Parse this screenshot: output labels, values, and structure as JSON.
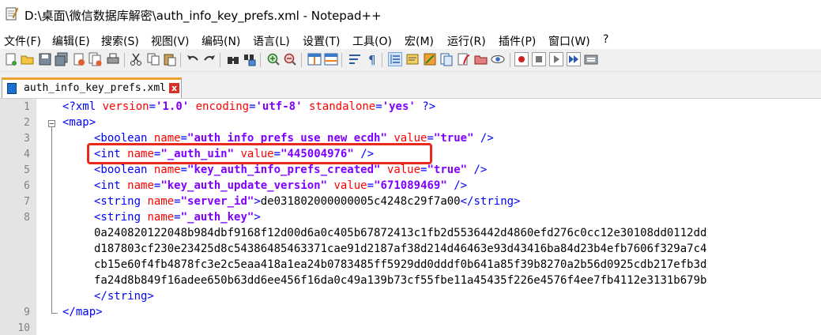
{
  "window": {
    "title": "D:\\桌面\\微信数据库解密\\auth_info_key_prefs.xml - Notepad++"
  },
  "menu": [
    {
      "label": "文件(F)"
    },
    {
      "label": "编辑(E)"
    },
    {
      "label": "搜索(S)"
    },
    {
      "label": "视图(V)"
    },
    {
      "label": "编码(N)"
    },
    {
      "label": "语言(L)"
    },
    {
      "label": "设置(T)"
    },
    {
      "label": "工具(O)"
    },
    {
      "label": "宏(M)"
    },
    {
      "label": "运行(R)"
    },
    {
      "label": "插件(P)"
    },
    {
      "label": "窗口(W)"
    },
    {
      "label": "?"
    }
  ],
  "toolbar": {
    "icons": [
      "new-file-icon",
      "open-file-icon",
      "save-icon",
      "save-all-icon",
      "close-icon",
      "close-all-icon",
      "print-icon",
      "cut-icon",
      "copy-icon",
      "paste-icon",
      "undo-icon",
      "redo-icon",
      "find-icon",
      "replace-icon",
      "zoom-in-icon",
      "zoom-out-icon",
      "sync-vertical-icon",
      "sync-horizontal-icon",
      "word-wrap-icon",
      "show-all-chars-icon",
      "indent-guide-icon",
      "language-icon",
      "doc-map-icon",
      "function-list-icon",
      "folder-workspace-icon",
      "monitoring-icon",
      "record-macro-icon",
      "stop-macro-icon",
      "play-macro-icon",
      "run-macro-multiple-icon",
      "save-macro-icon"
    ]
  },
  "tab": {
    "label": "auth_info_key_prefs.xml",
    "close": "x"
  },
  "line_numbers": [
    "1",
    "2",
    "3",
    "4",
    "5",
    "6",
    "7",
    "8",
    "9",
    "10"
  ],
  "lines": {
    "l1": {
      "p1": "<?xml ",
      "a1": "version",
      "p2": "=",
      "v1": "'1.0'",
      "p3": " ",
      "a2": "encoding",
      "p4": "=",
      "v2": "'utf-8'",
      "p5": " ",
      "a3": "standalone",
      "p6": "=",
      "v3": "'yes'",
      "p7": " ?>"
    },
    "l2": {
      "t1": "<map>"
    },
    "l3": {
      "t1": "<boolean ",
      "a1": "name",
      "t2": "=",
      "v1": "\"auth_info_prefs_use_new_ecdh\"",
      "t3": " ",
      "a2": "value",
      "t4": "=",
      "v2": "\"true\"",
      "t5": " />"
    },
    "l4": {
      "t1": "<int ",
      "a1": "name",
      "t2": "=",
      "v1": "\"_auth_uin\"",
      "t3": " ",
      "a2": "value",
      "t4": "=",
      "v2": "\"445004976\"",
      "t5": " />"
    },
    "l5": {
      "t1": "<boolean ",
      "a1": "name",
      "t2": "=",
      "v1": "\"key_auth_info_prefs_created\"",
      "t3": " ",
      "a2": "value",
      "t4": "=",
      "v2": "\"true\"",
      "t5": " />"
    },
    "l6": {
      "t1": "<int ",
      "a1": "name",
      "t2": "=",
      "v1": "\"key_auth_update_version\"",
      "t3": " ",
      "a2": "value",
      "t4": "=",
      "v2": "\"671089469\"",
      "t5": " />"
    },
    "l7": {
      "t1": "<string ",
      "a1": "name",
      "t2": "=",
      "v1": "\"server_id\"",
      "t3": ">",
      "text": "de031802000000005c4248c29f7a00",
      "t4": "</string>"
    },
    "l8": {
      "t1": "<string ",
      "a1": "name",
      "t2": "=",
      "v1": "\"_auth_key\"",
      "t3": ">"
    },
    "l8_wrap": [
      "0a240820122048b984dbf9168f12d00d6a0c405b67872413c1fb2d5536442d4860efd276c0cc12e30108dd0112dd",
      "d187803cf230e23425d8c54386485463371cae91d2187af38d214d46463e93d43416ba84d23b4efb7606f329a7c4",
      "cb15e60f4fb4878fc3e2c5eaa418a1ea24b0783485ff5929dd0dddf0b641a85f39b8270a2b56d0925cdb217efb3d",
      "fa24d8b849f16adee650b63dd6ee456f16da0c49a139b73cf55fbe11a45435f226e4576f4ee7fb4112e3131b679b"
    ],
    "l8_close": "</string>",
    "l9": {
      "t1": "</map>"
    }
  },
  "colors": {
    "highlight_box": "#e8291c",
    "tag": "#0000ff",
    "attribute": "#ff0000",
    "value": "#8000ff"
  }
}
